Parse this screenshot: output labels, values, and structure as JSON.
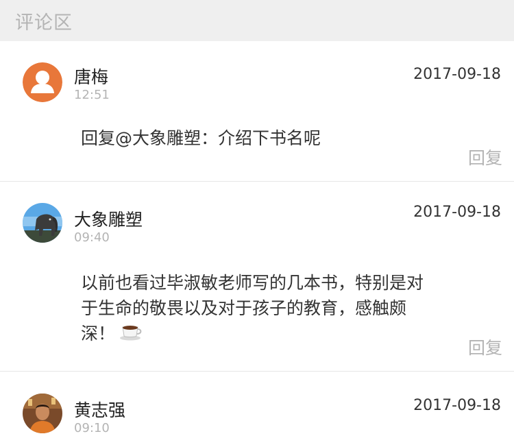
{
  "header": {
    "title": "评论区"
  },
  "comments": [
    {
      "name": "唐梅",
      "time": "12:51",
      "date": "2017-09-18",
      "content": "回复@大象雕塑：介绍下书名呢",
      "reply_label": "回复",
      "avatar": "default-person-avatar"
    },
    {
      "name": "大象雕塑",
      "time": "09:40",
      "date": "2017-09-18",
      "content_line1": "以前也看过毕淑敏老师写的几本书，特别是对",
      "content_line2": "于生命的敬畏以及对于孩子的教育，感触颇",
      "content_line3": "深！",
      "emoji": "coffee-cup-icon",
      "reply_label": "回复",
      "avatar": "elephant-sculpture-photo"
    },
    {
      "name": "黄志强",
      "time": "09:10",
      "date": "2017-09-18",
      "avatar": "person-photo"
    }
  ],
  "colors": {
    "header_bg": "#efefef",
    "muted_text": "#b4b4b4",
    "avatar_orange": "#e8773a"
  }
}
